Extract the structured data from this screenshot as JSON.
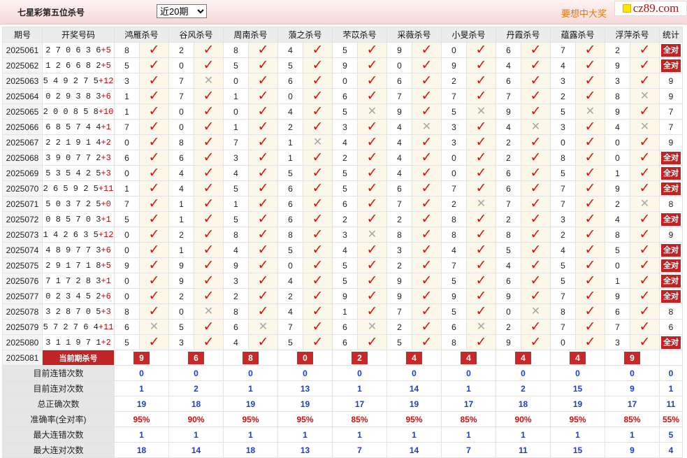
{
  "header": {
    "title": "七星彩第五位杀号",
    "select_value": "近20期",
    "promo": "要想中大奖",
    "logo": "cz89.com"
  },
  "table": {
    "header_period": "期号",
    "header_numbers": "开奖号码",
    "experts": [
      "鸿雁杀号",
      "谷风杀号",
      "周南杀号",
      "蒗之杀号",
      "芣苡杀号",
      "采薇杀号",
      "小旻杀号",
      "丹霞杀号",
      "蕴露杀号",
      "浮萍杀号"
    ],
    "header_stat": "统计",
    "full_label": "全对",
    "rows": [
      {
        "period": "2025061",
        "digits": "270636",
        "plus": "+5",
        "kills": [
          "8",
          "2",
          "8",
          "4",
          "5",
          "9",
          "0",
          "6",
          "7",
          "2"
        ],
        "marks": [
          1,
          1,
          1,
          1,
          1,
          1,
          1,
          1,
          1,
          1
        ],
        "stat": "全对"
      },
      {
        "period": "2025062",
        "digits": "126682",
        "plus": "+5",
        "kills": [
          "5",
          "0",
          "5",
          "5",
          "9",
          "0",
          "9",
          "4",
          "4",
          "9"
        ],
        "marks": [
          1,
          1,
          1,
          1,
          1,
          1,
          1,
          1,
          1,
          1
        ],
        "stat": "全对"
      },
      {
        "period": "2025063",
        "digits": "549275",
        "plus": "+12",
        "kills": [
          "3",
          "7",
          "0",
          "6",
          "0",
          "6",
          "2",
          "6",
          "3",
          "3"
        ],
        "marks": [
          1,
          0,
          1,
          1,
          1,
          1,
          1,
          1,
          1,
          1
        ],
        "stat": "9"
      },
      {
        "period": "2025064",
        "digits": "029383",
        "plus": "+6",
        "kills": [
          "1",
          "7",
          "1",
          "0",
          "6",
          "7",
          "7",
          "7",
          "2",
          "8"
        ],
        "marks": [
          1,
          1,
          1,
          1,
          1,
          1,
          1,
          1,
          1,
          0
        ],
        "stat": "9"
      },
      {
        "period": "2025065",
        "digits": "200858",
        "plus": "+10",
        "kills": [
          "1",
          "0",
          "0",
          "4",
          "5",
          "9",
          "5",
          "9",
          "5",
          "9"
        ],
        "marks": [
          1,
          1,
          1,
          1,
          0,
          1,
          0,
          1,
          0,
          1
        ],
        "stat": "7"
      },
      {
        "period": "2025066",
        "digits": "685744",
        "plus": "+1",
        "kills": [
          "7",
          "0",
          "1",
          "2",
          "3",
          "4",
          "3",
          "4",
          "3",
          "4"
        ],
        "marks": [
          1,
          1,
          1,
          1,
          1,
          0,
          1,
          0,
          1,
          0
        ],
        "stat": "7"
      },
      {
        "period": "2025067",
        "digits": "221914",
        "plus": "+2",
        "kills": [
          "0",
          "8",
          "7",
          "1",
          "4",
          "4",
          "3",
          "2",
          "0",
          "0"
        ],
        "marks": [
          1,
          1,
          1,
          0,
          1,
          1,
          1,
          1,
          1,
          1
        ],
        "stat": "9"
      },
      {
        "period": "2025068",
        "digits": "390772",
        "plus": "+3",
        "kills": [
          "6",
          "6",
          "3",
          "1",
          "2",
          "4",
          "0",
          "2",
          "8",
          "0"
        ],
        "marks": [
          1,
          1,
          1,
          1,
          1,
          1,
          1,
          1,
          1,
          1
        ],
        "stat": "全对"
      },
      {
        "period": "2025069",
        "digits": "535425",
        "plus": "+3",
        "kills": [
          "0",
          "4",
          "4",
          "5",
          "5",
          "4",
          "0",
          "6",
          "5",
          "1"
        ],
        "marks": [
          1,
          1,
          1,
          1,
          1,
          1,
          1,
          1,
          1,
          1
        ],
        "stat": "全对"
      },
      {
        "period": "2025070",
        "digits": "265925",
        "plus": "+11",
        "kills": [
          "1",
          "4",
          "5",
          "6",
          "5",
          "6",
          "7",
          "6",
          "7",
          "9"
        ],
        "marks": [
          1,
          1,
          1,
          1,
          1,
          1,
          1,
          1,
          1,
          1
        ],
        "stat": "全对"
      },
      {
        "period": "2025071",
        "digits": "503725",
        "plus": "+0",
        "kills": [
          "7",
          "1",
          "1",
          "6",
          "6",
          "7",
          "2",
          "7",
          "7",
          "2"
        ],
        "marks": [
          1,
          1,
          1,
          1,
          1,
          1,
          0,
          1,
          1,
          0
        ],
        "stat": "8"
      },
      {
        "period": "2025072",
        "digits": "085703",
        "plus": "+1",
        "kills": [
          "5",
          "1",
          "5",
          "6",
          "2",
          "2",
          "8",
          "2",
          "3",
          "4"
        ],
        "marks": [
          1,
          1,
          1,
          1,
          1,
          1,
          1,
          1,
          1,
          1
        ],
        "stat": "全对"
      },
      {
        "period": "2025073",
        "digits": "142635",
        "plus": "+12",
        "kills": [
          "0",
          "2",
          "8",
          "8",
          "3",
          "8",
          "8",
          "8",
          "2",
          "8"
        ],
        "marks": [
          1,
          1,
          1,
          1,
          0,
          1,
          1,
          1,
          1,
          1
        ],
        "stat": "9"
      },
      {
        "period": "2025074",
        "digits": "489773",
        "plus": "+6",
        "kills": [
          "0",
          "1",
          "4",
          "5",
          "4",
          "3",
          "4",
          "5",
          "4",
          "5"
        ],
        "marks": [
          1,
          1,
          1,
          1,
          1,
          1,
          1,
          1,
          1,
          1
        ],
        "stat": "全对"
      },
      {
        "period": "2025075",
        "digits": "291718",
        "plus": "+5",
        "kills": [
          "9",
          "9",
          "9",
          "0",
          "5",
          "2",
          "7",
          "4",
          "5",
          "0"
        ],
        "marks": [
          1,
          1,
          1,
          1,
          1,
          1,
          1,
          1,
          1,
          1
        ],
        "stat": "全对"
      },
      {
        "period": "2025076",
        "digits": "717283",
        "plus": "+1",
        "kills": [
          "0",
          "9",
          "3",
          "4",
          "5",
          "9",
          "5",
          "6",
          "5",
          "1"
        ],
        "marks": [
          1,
          1,
          1,
          1,
          1,
          1,
          1,
          1,
          1,
          1
        ],
        "stat": "全对"
      },
      {
        "period": "2025077",
        "digits": "023452",
        "plus": "+6",
        "kills": [
          "0",
          "2",
          "2",
          "2",
          "9",
          "9",
          "9",
          "9",
          "7",
          "9"
        ],
        "marks": [
          1,
          1,
          1,
          1,
          1,
          1,
          1,
          1,
          1,
          1
        ],
        "stat": "全对"
      },
      {
        "period": "2025078",
        "digits": "328705",
        "plus": "+3",
        "kills": [
          "8",
          "0",
          "8",
          "4",
          "1",
          "7",
          "5",
          "0",
          "8",
          "6"
        ],
        "marks": [
          1,
          0,
          1,
          1,
          1,
          1,
          1,
          0,
          1,
          1
        ],
        "stat": "8"
      },
      {
        "period": "2025079",
        "digits": "572764",
        "plus": "+11",
        "kills": [
          "6",
          "5",
          "6",
          "7",
          "6",
          "2",
          "6",
          "2",
          "7",
          "7"
        ],
        "marks": [
          0,
          1,
          0,
          1,
          0,
          1,
          0,
          1,
          1,
          1
        ],
        "stat": "6"
      },
      {
        "period": "2025080",
        "digits": "311971",
        "plus": "+2",
        "kills": [
          "5",
          "3",
          "4",
          "5",
          "6",
          "5",
          "8",
          "9",
          "0",
          "3"
        ],
        "marks": [
          1,
          1,
          1,
          1,
          1,
          1,
          1,
          1,
          1,
          1
        ],
        "stat": "全对"
      }
    ],
    "current": {
      "period": "2025081",
      "label": "当前期杀号",
      "values": [
        "9",
        "6",
        "8",
        "0",
        "2",
        "4",
        "4",
        "4",
        "4",
        "9"
      ]
    },
    "stats": [
      {
        "label": "目前连错次数",
        "values": [
          "0",
          "0",
          "0",
          "0",
          "0",
          "0",
          "0",
          "0",
          "0",
          "0"
        ],
        "total": "0",
        "pct": false
      },
      {
        "label": "目前连对次数",
        "values": [
          "1",
          "2",
          "1",
          "13",
          "1",
          "14",
          "1",
          "2",
          "15",
          "9"
        ],
        "total": "1",
        "pct": false
      },
      {
        "label": "总正确次数",
        "values": [
          "19",
          "18",
          "19",
          "19",
          "17",
          "19",
          "17",
          "18",
          "19",
          "17"
        ],
        "total": "11",
        "pct": false
      },
      {
        "label": "准确率(全对率)",
        "values": [
          "95%",
          "90%",
          "95%",
          "95%",
          "85%",
          "95%",
          "85%",
          "90%",
          "95%",
          "85%"
        ],
        "total": "55%",
        "pct": true
      },
      {
        "label": "最大连错次数",
        "values": [
          "1",
          "1",
          "1",
          "1",
          "1",
          "1",
          "1",
          "1",
          "1",
          "1"
        ],
        "total": "5",
        "pct": false
      },
      {
        "label": "最大连对次数",
        "values": [
          "18",
          "14",
          "18",
          "13",
          "7",
          "14",
          "7",
          "11",
          "15",
          "9"
        ],
        "total": "4",
        "pct": false
      }
    ]
  }
}
